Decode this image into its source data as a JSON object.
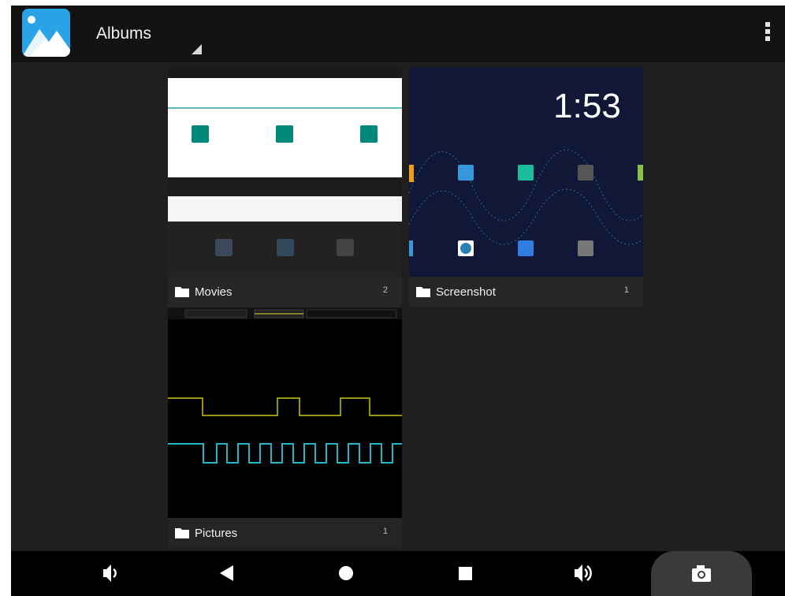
{
  "appbar": {
    "title": "Albums"
  },
  "albums": [
    {
      "name": "Movies",
      "count": "2"
    },
    {
      "name": "Screenshot",
      "count": "1"
    },
    {
      "name": "Pictures",
      "count": "1"
    }
  ],
  "thumb_screenshot": {
    "clock": "1:53"
  },
  "colors": {
    "appbar": "#121212",
    "background": "#1f1f1f",
    "accent": "#00897b",
    "icon_blue": "#29a3e6"
  }
}
